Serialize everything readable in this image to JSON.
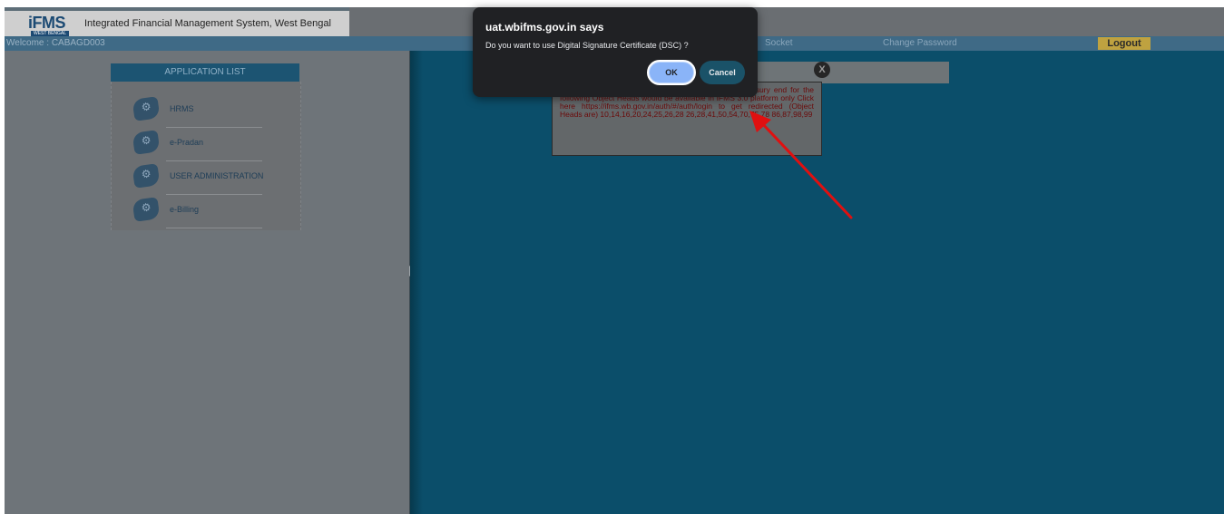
{
  "header": {
    "logo_text": "iFMS",
    "logo_subtext": "WEST BENGAL",
    "title": "Integrated Financial Management System, West Bengal"
  },
  "navbar": {
    "welcome": "Welcome : CABAGD003",
    "socket_label": "Socket",
    "change_password": "Change Password",
    "logout": "Logout"
  },
  "app_list": {
    "title": "APPLICATION LIST",
    "items": [
      {
        "label": "HRMS",
        "icon": "gear-icon"
      },
      {
        "label": "e-Pradan",
        "icon": "gear-icon"
      },
      {
        "label": "USER ADMINISTRATION",
        "icon": "gear-icon"
      },
      {
        "label": "e-Billing",
        "icon": "gear-icon"
      }
    ]
  },
  "notice": {
    "text": "and submission of Bills and processing thereof at treasury end for the following Object Heads would be available in IFMS 3.0 platform only Click here https://ifms.wb.gov.in/auth/#/auth/login to get redirected (Object Heads are) 10,14,16,20,24,25,26,28 26,28,41,50,54,70,75,78 86,87,98,99",
    "close_label": "X"
  },
  "dialog": {
    "title": "uat.wbifms.gov.in says",
    "message": "Do you want to use Digital Signature Certificate (DSC) ?",
    "ok_label": "OK",
    "cancel_label": "Cancel"
  },
  "colors": {
    "navbar": "#3f6a86",
    "right_pane": "#0b4e6a",
    "logout": "#bfa240",
    "annotation_arrow": "#e01010",
    "ok_button": "#8ab4f8"
  }
}
